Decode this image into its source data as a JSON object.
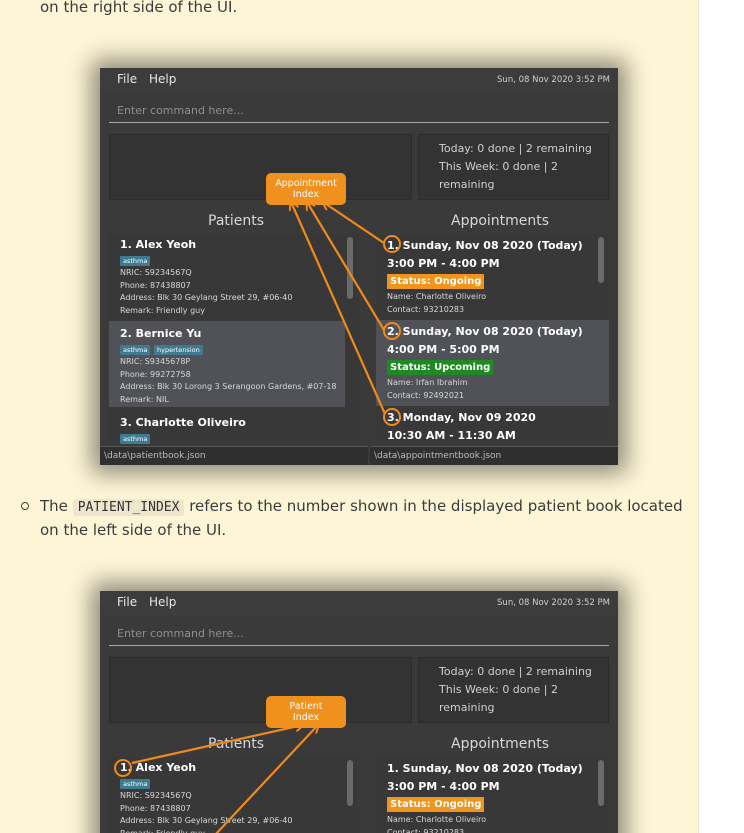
{
  "doc": {
    "top_text": "on the right side of the UI.",
    "para2_prefix": "The",
    "para2_code": "PATIENT_INDEX",
    "para2_suffix_line1": "refers to the number shown in the displayed patient book located",
    "para2_line2": "on the left side of the UI."
  },
  "app": {
    "menu_file": "File",
    "menu_help": "Help",
    "datetime": "Sun, 08 Nov 2020 3:52 PM",
    "command_placeholder": "Enter command here...",
    "stats_today": "Today: 0 done | 2 remaining",
    "stats_week": "This Week: 0 done | 2 remaining",
    "patients_title": "Patients",
    "appointments_title": "Appointments",
    "patients": [
      {
        "name": "1.  Alex Yeoh",
        "tags": [
          "asthma"
        ],
        "nric": "NRIC: S9234567Q",
        "phone": "Phone: 87438807",
        "address": "Address: Blk 30 Geylang Street 29, #06-40",
        "remark": "Remark: Friendly guy"
      },
      {
        "name": "2.  Bernice Yu",
        "tags": [
          "asthma",
          "hypertension"
        ],
        "nric": "NRIC: S9345678P",
        "phone": "Phone: 99272758",
        "address": "Address: Blk 30 Lorong 3 Serangoon Gardens, #07-18",
        "remark": "Remark: NIL"
      },
      {
        "name": "3.  Charlotte Oliveiro",
        "tags": [
          "asthma"
        ]
      }
    ],
    "appointments": [
      {
        "title": "1.  Sunday, Nov 08 2020 (Today)",
        "time": "3:00 PM  -  4:00 PM",
        "status": "Status: Ongoing",
        "name": "Name: Charlotte Oliveiro",
        "contact": "Contact: 93210283"
      },
      {
        "title": "2.  Sunday, Nov 08 2020 (Today)",
        "time": "4:00 PM  -  5:00 PM",
        "status": "Status: Upcoming",
        "name": "Name: Irfan Ibrahim",
        "contact": "Contact: 92492021"
      },
      {
        "title": "3.  Monday, Nov 09 2020",
        "time": "10:30 AM  -  11:30 AM"
      }
    ],
    "footer_patients": "\\data\\patientbook.json",
    "footer_appointments": "\\data\\appointmentbook.json"
  },
  "callouts": {
    "appointment_line1": "Appointment",
    "appointment_line2": "Index",
    "patient_line1": "Patient",
    "patient_line2": "Index"
  },
  "colors": {
    "page_bg": "#fdf5d6",
    "app_bg": "#3a3a3a",
    "accent_orange": "#f0901d",
    "status_ongoing": "#f0941c",
    "status_upcoming": "#1f8a24",
    "tag_blue": "#3e7b91"
  }
}
